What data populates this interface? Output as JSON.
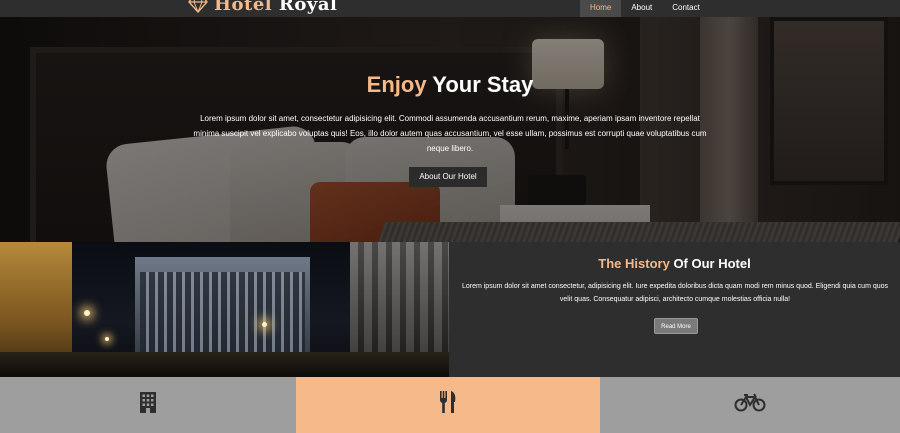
{
  "header": {
    "logo": {
      "word1": "Hotel",
      "word2": "Royal",
      "icon": "diamond-icon"
    },
    "nav": [
      {
        "label": "Home",
        "active": true
      },
      {
        "label": "About",
        "active": false
      },
      {
        "label": "Contact",
        "active": false
      }
    ]
  },
  "hero": {
    "title_accent": "Enjoy",
    "title_rest": "Your Stay",
    "text": "Lorem ipsum dolor sit amet, consectetur adipisicing elit. Commodi assumenda accusantium rerum, maxime, aperiam ipsam inventore repellat minima suscipit vel explicabo voluptas quis! Eos, illo dolor autem quas accusantium, vel esse ullam, possimus est corrupti quae voluptatibus cum neque libero.",
    "button": "About Our Hotel"
  },
  "history": {
    "title_pre": "The",
    "title_accent": "History",
    "title_rest": "Of Our Hotel",
    "text": "Lorem ipsum dolor sit amet consectetur, adipisicing elit. Iure expedita doloribus dicta quam modi rem minus quod. Eligendi quia cum quos velit quas. Consequatur adipisci, architecto cumque molestias officia nulla!",
    "button": "Read More"
  },
  "features": [
    {
      "icon": "building-icon"
    },
    {
      "icon": "utensils-icon"
    },
    {
      "icon": "bicycle-icon"
    }
  ],
  "colors": {
    "accent": "#f5b98a",
    "dark": "#2e2e2e",
    "gray": "#9e9e9e"
  }
}
